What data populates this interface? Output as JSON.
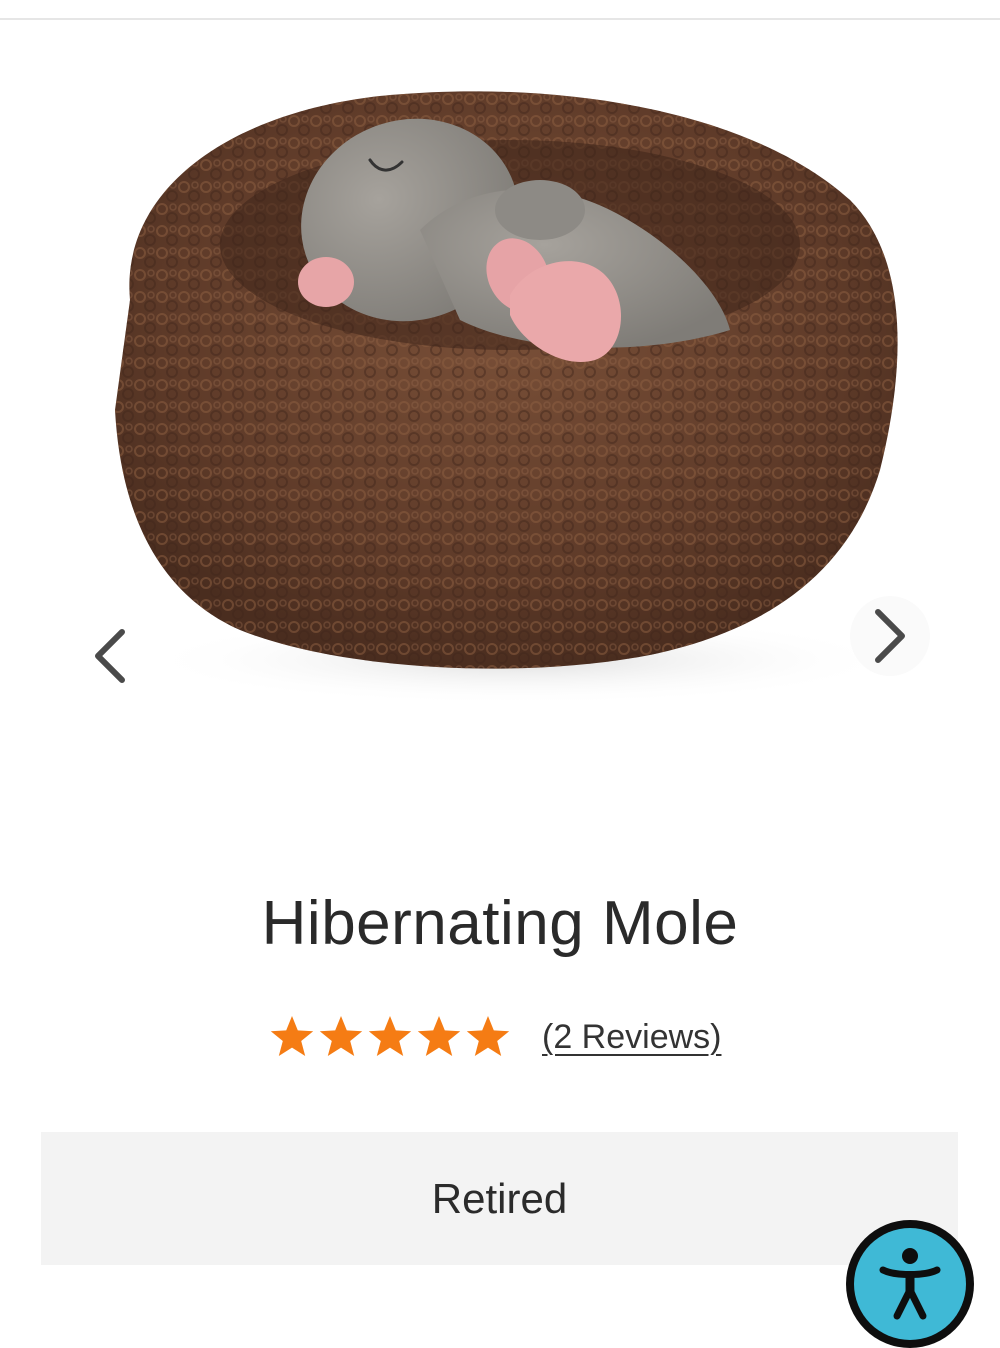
{
  "product": {
    "title": "Hibernating Mole",
    "rating": 5,
    "rating_max": 5,
    "reviews_label": "(2 Reviews)",
    "status": "Retired"
  },
  "gallery": {
    "prev_icon": "chevron-left-icon",
    "next_icon": "chevron-right-icon"
  },
  "accessibility": {
    "icon": "accessibility-icon"
  },
  "colors": {
    "star": "#F57C14",
    "status_bg": "#F3F3F3",
    "a11y_ring": "#0E0E0E",
    "a11y_fill": "#3FB9D6",
    "nest": "#6A4330",
    "mole": "#8F8C87"
  }
}
